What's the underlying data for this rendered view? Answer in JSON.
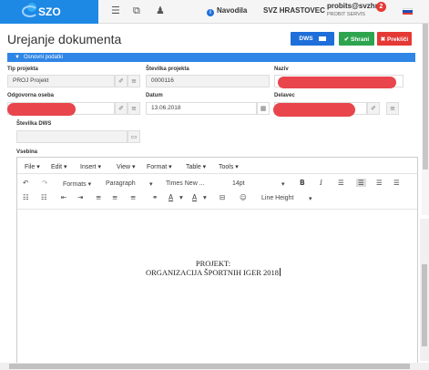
{
  "topbar": {
    "brand": "SZO",
    "navodila": "Navodila",
    "organization": "SVZ HRASTOVEC",
    "user": "probits@svzhra",
    "user_sub": "PROBIT SERVIS",
    "notifications": "2"
  },
  "header": {
    "title": "Urejanje dokumenta",
    "dws_label": "DWS",
    "save_label": "✔ Shrani",
    "cancel_label": "✖ Prekliči"
  },
  "section": {
    "label": "Osnovni podatki"
  },
  "form": {
    "tip_projekta_label": "Tip projekta",
    "tip_projekta_value": "PROJ Projekt",
    "stevilka_projekta_label": "Številka projekta",
    "stevilka_projekta_value": "0000116",
    "naziv_label": "Naziv",
    "odgovorna_oseba_label": "Odgovorna oseba",
    "datum_label": "Datum",
    "datum_value": "13.06.2018",
    "delavec_label": "Delavec",
    "stevilka_dws_label": "Številka DWS",
    "vsebina_label": "Vsebina"
  },
  "editor": {
    "menu": [
      "File ▾",
      "Edit ▾",
      "Insert ▾",
      "View ▾",
      "Format ▾",
      "Table ▾",
      "Tools ▾"
    ],
    "formats_label": "Formats ▾",
    "paragraph_label": "Paragraph",
    "font_label": "Times New ...",
    "size_label": "14pt",
    "line_height_label": "Line Height",
    "doc_line1": "PROJEKT:",
    "doc_line2": "ORGANIZACIJA ŠPORTNIH IGER 2018"
  }
}
